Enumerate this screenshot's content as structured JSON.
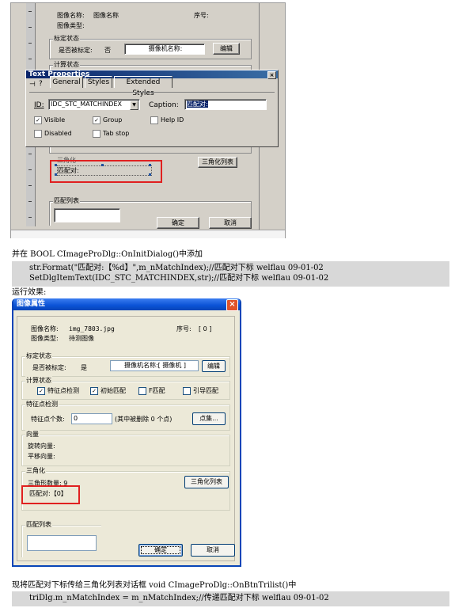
{
  "shot1": {
    "header": {
      "image_name_label": "图像名称:",
      "image_name_value": "图像名称",
      "image_type_label": "图像类型:",
      "serial_label": "序号:"
    },
    "calib_group": "标定状态",
    "calib_label": "是否被标定:",
    "calib_value": "否",
    "camera_label": "摄像机名称:",
    "edit_button": "编辑",
    "calc_group": "计算状态",
    "tri_partial": "三角化",
    "tri_list_button": "三角化列表",
    "match_label": "匹配对:",
    "match_list_group": "匹配列表",
    "ok_button": "确定",
    "cancel_button": "取消",
    "text_properties": {
      "title": "Text Properties",
      "tabs": [
        "General",
        "Styles",
        "Extended Styles"
      ],
      "id_label": "ID:",
      "id_value": "IDC_STC_MATCHINDEX",
      "caption_label": "Caption:",
      "caption_value": "匹配对:",
      "visible": "Visible",
      "group": "Group",
      "help_id": "Help ID",
      "disabled": "Disabled",
      "tab_stop": "Tab stop"
    }
  },
  "text1": "并在 BOOL CImageProDlg::OnInitDialog()中添加",
  "code1": [
    "str.Format(\"匹配对:【%d】\",m_nMatchIndex);//匹配对下标  welflau 09-01-02",
    "SetDlgItemText(IDC_STC_MATCHINDEX,str);//匹配对下标  welflau 09-01-02"
  ],
  "text2": "运行效果:",
  "shot2": {
    "title": "图像属性",
    "image_name_label": "图像名称:",
    "image_name_value": "img_7803.jpg",
    "serial_label": "序号:",
    "serial_value": "[ 0 ]",
    "image_type_label": "图像类型:",
    "image_type_value": "待测图像",
    "calib_group": "标定状态",
    "calib_label": "是否被标定:",
    "calib_value": "是",
    "camera_label": "摄像机名称:[ 摄像机 ]",
    "edit_button": "编辑",
    "calc_group": "计算状态",
    "checks": [
      {
        "label": "特征点检测",
        "checked": true
      },
      {
        "label": "初始匹配",
        "checked": true
      },
      {
        "label": "F匹配",
        "checked": false
      },
      {
        "label": "引导匹配",
        "checked": false
      }
    ],
    "feature_group": "特征点检测",
    "feature_label": "特征点个数:",
    "feature_value": "0",
    "feature_note": "(其中被删除  0  个点)",
    "points_button": "点集...",
    "vector_group": "向量",
    "rotation_label": "旋转向量:",
    "translation_label": "平移向量:",
    "tri_group": "三角化",
    "tri_count_label": "三角形数量: 9",
    "tri_list_button": "三角化列表",
    "match_label": "匹配对:【0】",
    "match_list_group": "匹配列表",
    "ok_button": "确定",
    "cancel_button": "取消"
  },
  "text3": "现将匹配对下标传给三角化列表对话框 void CImageProDlg::OnBtnTrilist()中",
  "code2": "triDlg.m_nMatchIndex = m_nMatchIndex;//传递匹配对下标  welflau 09-01-02"
}
